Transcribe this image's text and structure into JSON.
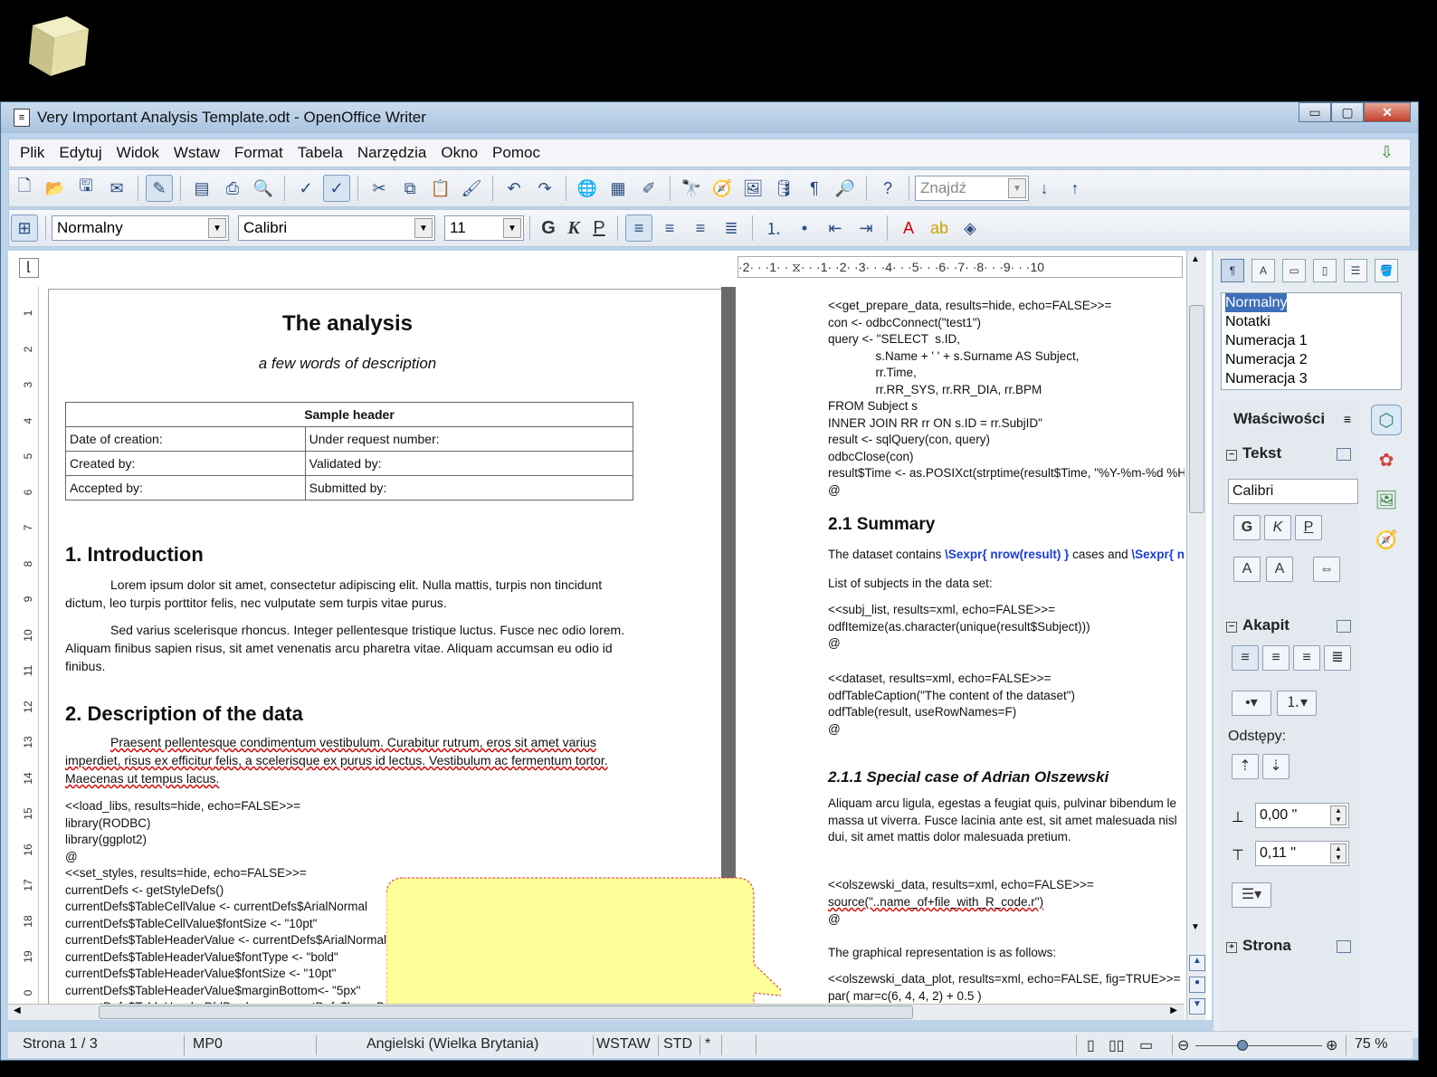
{
  "window": {
    "title": "Very Important Analysis Template.odt - OpenOffice Writer",
    "minimize": "▭",
    "maximize": "▢",
    "close": "✕"
  },
  "menu": [
    "Plik",
    "Edytuj",
    "Widok",
    "Wstaw",
    "Format",
    "Tabela",
    "Narzędzia",
    "Okno",
    "Pomoc"
  ],
  "toolbar": {
    "find_placeholder": "Znajdź",
    "style_value": "Normalny",
    "font_value": "Calibri",
    "size_value": "11",
    "bold": "G",
    "italic": "K",
    "underline": "P"
  },
  "ruler": {
    "h_text": "·2· · ·1· · ⧖· · ·1· ·2· ·3· · ·4· · ·5· · ·6· ·7· ·8· · ·9· · ·10",
    "v_numbers": [
      "1",
      "2",
      "3",
      "4",
      "5",
      "6",
      "7",
      "8",
      "9",
      "10",
      "11",
      "12",
      "13",
      "14",
      "15",
      "16",
      "17",
      "18",
      "19",
      "0"
    ]
  },
  "left_page": {
    "title": "The analysis",
    "subtitle": "a few words of description",
    "table": {
      "header": "Sample header",
      "rows": [
        [
          "Date of creation:",
          "Under request number:"
        ],
        [
          "Created by:",
          "Validated by:"
        ],
        [
          "Accepted by:",
          "Submitted by:"
        ]
      ]
    },
    "h1_intro": "1. Introduction",
    "p1": "Lorem ipsum dolor sit amet, consectetur adipiscing elit. Nulla mattis, turpis non tincidunt dictum, leo turpis porttitor felis, nec vulputate sem turpis vitae purus.",
    "p2": "Sed varius scelerisque rhoncus. Integer pellentesque tristique luctus. Fusce nec odio lorem. Aliquam finibus sapien risus, sit amet venenatis arcu pharetra vitae. Aliquam accumsan eu odio id finibus.",
    "h1_desc": "2. Description of the data",
    "p3": "Praesent pellentesque condimentum vestibulum. Curabitur rutrum, eros sit amet varius imperdiet, risus ex efficitur felis, a scelerisque ex purus id lectus. Vestibulum ac fermentum tortor. Maecenas ut tempus lacus.",
    "code": "<<load_libs, results=hide, echo=FALSE>>=\nlibrary(RODBC)\nlibrary(ggplot2)\n@\n<<set_styles, results=hide, echo=FALSE>>=\ncurrentDefs <- getStyleDefs()\ncurrentDefs$TableCellValue <- currentDefs$ArialNormal\ncurrentDefs$TableCellValue$fontSize <- \"10pt\"\ncurrentDefs$TableHeaderValue <- currentDefs$ArialNormal\ncurrentDefs$TableHeaderValue$fontType <- \"bold\"\ncurrentDefs$TableHeaderValue$fontSize <- \"10pt\"\ncurrentDefs$TableHeaderValue$marginBottom<- \"5px\"\ncurrentDefs$TableHeaderDblBorder <- currentDefs$lowerBorder"
  },
  "right_page": {
    "code1": "<<get_prepare_data, results=hide, echo=FALSE>>=\ncon <- odbcConnect(\"test1\")\nquery <- \"SELECT  s.ID,\n              s.Name + ' ' + s.Surname AS Subject,\n              rr.Time,\n              rr.RR_SYS, rr.RR_DIA, rr.BPM\nFROM Subject s\nINNER JOIN RR rr ON s.ID = rr.SubjID\"\nresult <- sqlQuery(con, query)\nodbcClose(con)\nresult$Time <- as.POSIXct(strptime(result$Time, \"%Y-%m-%d %H\n@",
    "h_summary": "2.1 Summary",
    "summary_a": "The dataset contains ",
    "summary_sexpr1": "\\Sexpr{ nrow(result) }",
    "summary_b": " cases and ",
    "summary_sexpr2": "\\Sexpr{ n",
    "list_text": "List of subjects in the data set:",
    "code2": "<<subj_list, results=xml, echo=FALSE>>=\nodfItemize(as.character(unique(result$Subject)))\n@",
    "code3": "<<dataset, results=xml, echo=FALSE>>=\nodfTableCaption(\"The content of the dataset\")\nodfTable(result, useRowNames=F)\n@",
    "h_special": "2.1.1 Special case of Adrian Olszewski",
    "special_text": "Aliquam arcu ligula, egestas a feugiat quis, pulvinar bibendum le\nmassa ut viverra. Fusce lacinia ante est, sit amet malesuada nisl\ndui, sit amet mattis dolor malesuada pretium.",
    "code4a": "<<olszewski_data, results=xml, echo=FALSE>>=",
    "code4b": "source(\"..name_of+file_with_R_code.r\")",
    "code4c": "@",
    "graph_text": "The graphical representation is as follows:",
    "code5": "<<olszewski_data_plot, results=xml, echo=FALSE, fig=TRUE>>=\npar( mar=c(6, 4, 4, 2) + 0.5 )"
  },
  "sidebar": {
    "styles": [
      "Normalny",
      "Notatki",
      "Numeracja 1",
      "Numeracja 2",
      "Numeracja 3"
    ],
    "properties_title": "Właściwości",
    "text_section": "Tekst",
    "font_value": "Calibri",
    "paragraph_section": "Akapit",
    "spacing_label": "Odstępy:",
    "spacing_above": "0,00 \"",
    "spacing_below": "0,11 \"",
    "page_section": "Strona"
  },
  "statusbar": {
    "page": "Strona  1 / 3",
    "style": "MP0",
    "language": "Angielski (Wielka Brytania)",
    "insert_mode": "WSTAW",
    "selection_mode": "STD",
    "modified": "*",
    "zoom": "75 %"
  }
}
